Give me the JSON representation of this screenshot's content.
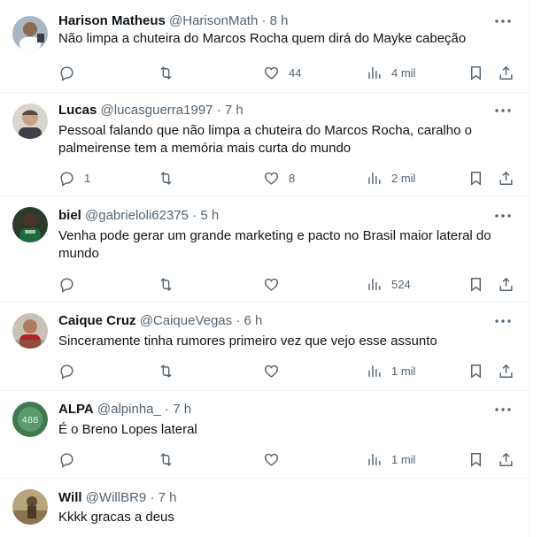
{
  "tweets": [
    {
      "name": "Harison Matheus",
      "handle": "@HarisonMath",
      "sep": "·",
      "time": "8 h",
      "text": "Não limpa a chuteira do Marcos Rocha quem dirá do Mayke cabeção",
      "replies": "",
      "retweets": "",
      "likes": "44",
      "views": "4 mil"
    },
    {
      "name": "Lucas",
      "handle": "@lucasguerra1997",
      "sep": "·",
      "time": "7 h",
      "text": "Pessoal falando que não limpa a chuteira do Marcos Rocha, caralho o palmeirense tem a memória mais curta do mundo",
      "replies": "1",
      "retweets": "",
      "likes": "8",
      "views": "2 mil"
    },
    {
      "name": "biel",
      "handle": "@gabrieloli62375",
      "sep": "·",
      "time": "5 h",
      "text": "Venha pode gerar um grande marketing e pacto no Brasil maior lateral do mundo",
      "replies": "",
      "retweets": "",
      "likes": "",
      "views": "524"
    },
    {
      "name": "Caique Cruz",
      "handle": "@CaiqueVegas",
      "sep": "·",
      "time": "6 h",
      "text": "Sinceramente tinha rumores primeiro vez que vejo esse assunto",
      "replies": "",
      "retweets": "",
      "likes": "",
      "views": "1 mil"
    },
    {
      "name": "ALPA",
      "handle": "@alpinha_",
      "sep": "·",
      "time": "7 h",
      "text": "É o Breno Lopes lateral",
      "replies": "",
      "retweets": "",
      "likes": "",
      "views": "1 mil"
    },
    {
      "name": "Will",
      "handle": "@WillBR9",
      "sep": "·",
      "time": "7 h",
      "text": "Kkkk gracas a deus",
      "replies": "",
      "retweets": "",
      "likes": "",
      "views": ""
    }
  ],
  "icons": {
    "reply": "reply-icon",
    "retweet": "retweet-icon",
    "like": "like-icon",
    "views": "views-icon",
    "bookmark": "bookmark-icon",
    "share": "share-icon",
    "more": "more-icon"
  },
  "colors": {
    "text": "#0f1419",
    "secondary": "#536471",
    "divider": "#eff3f4"
  }
}
